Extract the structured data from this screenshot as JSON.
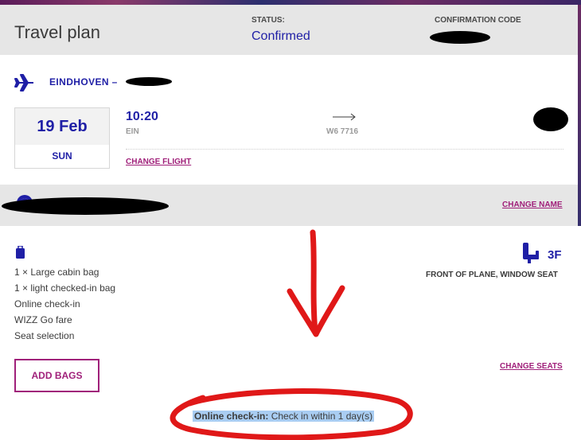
{
  "header": {
    "title": "Travel plan",
    "status_label": "STATUS:",
    "status_value": "Confirmed",
    "confirmation_label": "CONFIRMATION CODE",
    "confirmation_value": ""
  },
  "flight": {
    "route_from": "EINDHOVEN –",
    "date": "19 Feb",
    "weekday": "SUN",
    "departure_time": "10:20",
    "departure_code": "EIN",
    "flight_number": "W6 7716",
    "arrival_time": "",
    "arrival_code": "",
    "change_flight": "CHANGE FLIGHT"
  },
  "passenger": {
    "name": "",
    "change_name": "CHANGE NAME"
  },
  "services": {
    "items": [
      "1 × Large cabin bag",
      "1 × light checked-in bag",
      "Online check-in",
      "WIZZ Go fare",
      "Seat selection"
    ],
    "seat_number": "3F",
    "seat_description": "FRONT OF PLANE, WINDOW SEAT",
    "add_bags": "ADD BAGS",
    "change_seats": "CHANGE SEATS",
    "checkin_label": "Online check-in:",
    "checkin_text": " Check in within 1 day(s)"
  },
  "icons": {
    "plane": "airplane-icon",
    "avatar": "passenger-avatar-icon",
    "bag": "luggage-icon",
    "seat": "seat-icon",
    "arrow": "arrow-right-icon"
  },
  "colors": {
    "primary": "#1f1fa6",
    "accent": "#a0207a",
    "highlight": "#a9cdf2",
    "annotation": "#e01818"
  }
}
